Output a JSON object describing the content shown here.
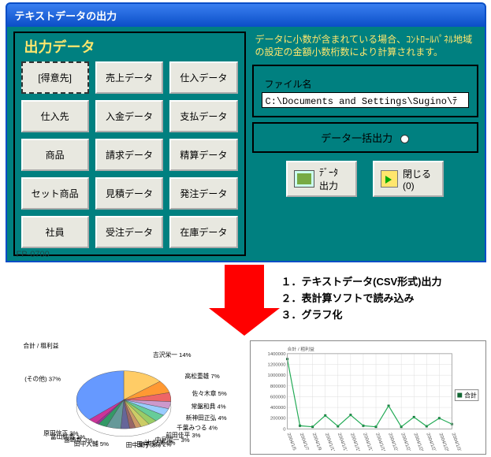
{
  "window": {
    "title": "テキストデータの出力",
    "form_id": "FP-0700"
  },
  "left": {
    "title": "出力データ",
    "buttons": [
      {
        "label": "[得意先]",
        "selected": true
      },
      {
        "label": "売上データ"
      },
      {
        "label": "仕入データ"
      },
      {
        "label": "仕入先"
      },
      {
        "label": "入金データ"
      },
      {
        "label": "支払データ"
      },
      {
        "label": "商品"
      },
      {
        "label": "請求データ"
      },
      {
        "label": "精算データ"
      },
      {
        "label": "セット商品"
      },
      {
        "label": "見積データ"
      },
      {
        "label": "発注データ"
      },
      {
        "label": "社員"
      },
      {
        "label": "受注データ"
      },
      {
        "label": "在庫データ"
      }
    ]
  },
  "right": {
    "notice": "データに小数が含まれている場合、ｺﾝﾄﾛｰﾙﾊﾟﾈﾙ地域の設定の金額小数桁数により計算されます。",
    "file_label": "ファイル名",
    "file_value": "C:\\Documents and Settings\\Sugino\\ﾃ",
    "batch_label": "データ一括出力",
    "export_label": "ﾃﾞｰﾀ\n出力",
    "close_label": "閉じる\n(0)"
  },
  "steps": {
    "s1": "１．テキストデータ(CSV形式)出力",
    "s2": "２．表計算ソフトで読み込み",
    "s3": "３．グラフ化"
  },
  "chart_data": [
    {
      "type": "pie",
      "title": "合計 / 粗利益",
      "series": [
        {
          "name": "吉沢栄一",
          "value": 14
        },
        {
          "name": "高松重雄",
          "value": 7
        },
        {
          "name": "佐々木章",
          "value": 5
        },
        {
          "name": "常盤和典",
          "value": 4
        },
        {
          "name": "新神田正弘",
          "value": 4
        },
        {
          "name": "千葉みつる",
          "value": 4
        },
        {
          "name": "前田佳平",
          "value": 3
        },
        {
          "name": "中見陽一",
          "value": 3
        },
        {
          "name": "辻 好美",
          "value": 2
        },
        {
          "name": "田村恭介",
          "value": 2
        },
        {
          "name": "田中栄子",
          "value": 3
        },
        {
          "name": "田中大輔",
          "value": 5
        },
        {
          "name": "島崎章",
          "value": 3
        },
        {
          "name": "富山純貴",
          "value": 1
        },
        {
          "name": "原田信正",
          "value": 3
        },
        {
          "name": "(その他)",
          "value": 37
        }
      ]
    },
    {
      "type": "line",
      "title": "合計 / 粗利益",
      "legend": "合計",
      "ylim": [
        0,
        1400000
      ],
      "yticks": [
        0,
        200000,
        400000,
        600000,
        800000,
        1000000,
        1200000,
        1400000
      ],
      "x": [
        "2004/1/5",
        "2004/1/7",
        "2004/1/9",
        "2004/1/11",
        "2004/1/13",
        "2004/1/15",
        "2004/1/17",
        "2004/1/19",
        "2004/1/21",
        "2004/1/23",
        "2004/1/25",
        "2004/1/27",
        "2004/1/29",
        "2004/1/31"
      ],
      "values": [
        1300000,
        60000,
        40000,
        250000,
        50000,
        260000,
        60000,
        40000,
        430000,
        40000,
        220000,
        50000,
        200000,
        90000
      ]
    }
  ]
}
